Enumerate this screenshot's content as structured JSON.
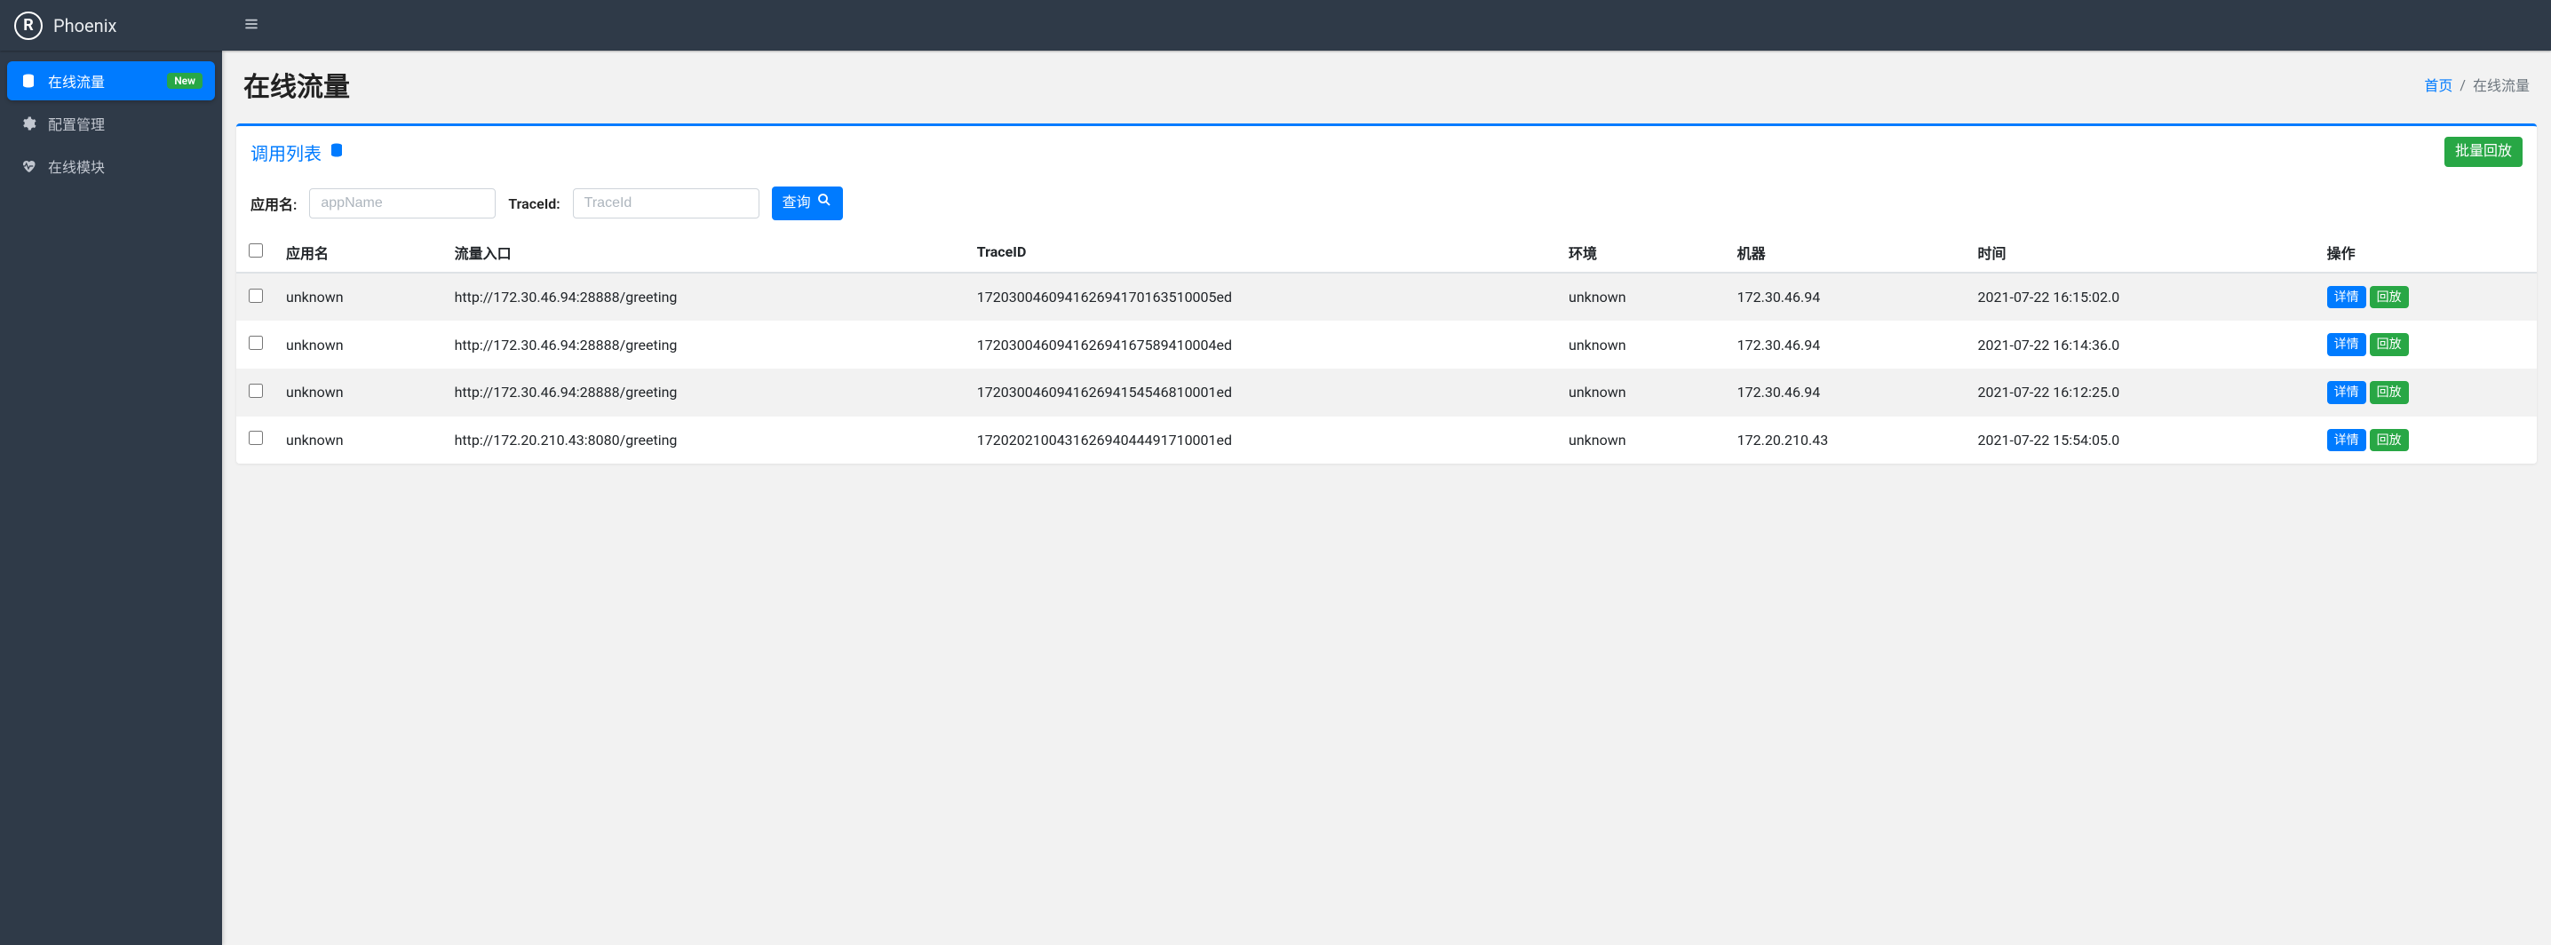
{
  "brand": {
    "title": "Phoenix",
    "logo_letter": "R"
  },
  "sidebar": {
    "items": [
      {
        "label": "在线流量",
        "badge": "New",
        "active": true,
        "icon": "database-icon"
      },
      {
        "label": "配置管理",
        "icon": "cogs-icon"
      },
      {
        "label": "在线模块",
        "icon": "heartbeat-icon"
      }
    ]
  },
  "header": {
    "title": "在线流量",
    "breadcrumb": {
      "home": "首页",
      "current": "在线流量",
      "sep": "/"
    }
  },
  "card": {
    "title": "调用列表",
    "batch_replay": "批量回放"
  },
  "filters": {
    "app_label": "应用名:",
    "app_placeholder": "appName",
    "traceid_label": "TraceId:",
    "traceid_placeholder": "TraceId",
    "query": "查询"
  },
  "table": {
    "headers": {
      "app": "应用名",
      "entry": "流量入口",
      "traceid": "TraceID",
      "env": "环境",
      "host": "机器",
      "time": "时间",
      "action": "操作"
    },
    "action_detail": "详情",
    "action_replay": "回放",
    "rows": [
      {
        "app": "unknown",
        "entry": "http://172.30.46.94:28888/greeting",
        "traceid": "172030046094162694170163510005ed",
        "env": "unknown",
        "host": "172.30.46.94",
        "time": "2021-07-22 16:15:02.0"
      },
      {
        "app": "unknown",
        "entry": "http://172.30.46.94:28888/greeting",
        "traceid": "172030046094162694167589410004ed",
        "env": "unknown",
        "host": "172.30.46.94",
        "time": "2021-07-22 16:14:36.0"
      },
      {
        "app": "unknown",
        "entry": "http://172.30.46.94:28888/greeting",
        "traceid": "172030046094162694154546810001ed",
        "env": "unknown",
        "host": "172.30.46.94",
        "time": "2021-07-22 16:12:25.0"
      },
      {
        "app": "unknown",
        "entry": "http://172.20.210.43:8080/greeting",
        "traceid": "172020210043162694044491710001ed",
        "env": "unknown",
        "host": "172.20.210.43",
        "time": "2021-07-22 15:54:05.0"
      }
    ]
  }
}
